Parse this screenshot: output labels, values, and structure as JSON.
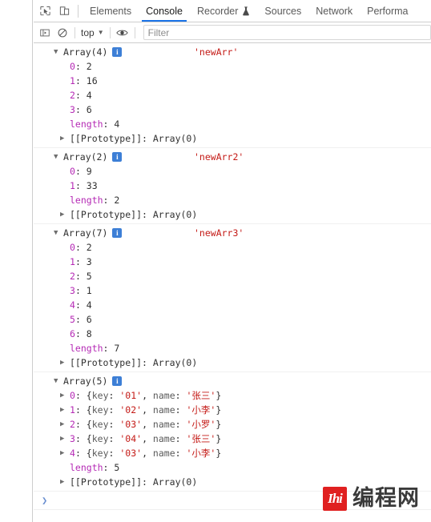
{
  "window": {
    "left_gutter_visible": true
  },
  "tabbar": {
    "inspect_icon": "inspect-element-icon",
    "device_icon": "device-toolbar-icon",
    "tabs": [
      {
        "label": "Elements",
        "active": false,
        "icon": null
      },
      {
        "label": "Console",
        "active": true,
        "icon": null
      },
      {
        "label": "Recorder",
        "active": false,
        "icon": "beaker-icon"
      },
      {
        "label": "Sources",
        "active": false,
        "icon": null
      },
      {
        "label": "Network",
        "active": false,
        "icon": null
      },
      {
        "label": "Performa",
        "active": false,
        "icon": null
      }
    ]
  },
  "consolebar": {
    "sidebar_icon": "console-sidebar-icon",
    "clear_icon": "clear-console-icon",
    "context_label": "top",
    "context_caret": "▼",
    "eye_icon": "live-expression-eye-icon",
    "filter_placeholder": "Filter",
    "filter_value": ""
  },
  "console": {
    "entries": [
      {
        "header": "Array(4)",
        "badge": "i",
        "label": "'newArr'",
        "children": [
          {
            "key": "0",
            "value": "2"
          },
          {
            "key": "1",
            "value": "16"
          },
          {
            "key": "2",
            "value": "4"
          },
          {
            "key": "3",
            "value": "6"
          }
        ],
        "length_key": "length",
        "length_value": "4",
        "proto_key": "[[Prototype]]",
        "proto_value": "Array(0)"
      },
      {
        "header": "Array(2)",
        "badge": "i",
        "label": "'newArr2'",
        "children": [
          {
            "key": "0",
            "value": "9"
          },
          {
            "key": "1",
            "value": "33"
          }
        ],
        "length_key": "length",
        "length_value": "2",
        "proto_key": "[[Prototype]]",
        "proto_value": "Array(0)"
      },
      {
        "header": "Array(7)",
        "badge": "i",
        "label": "'newArr3'",
        "children": [
          {
            "key": "0",
            "value": "2"
          },
          {
            "key": "1",
            "value": "3"
          },
          {
            "key": "2",
            "value": "5"
          },
          {
            "key": "3",
            "value": "1"
          },
          {
            "key": "4",
            "value": "4"
          },
          {
            "key": "5",
            "value": "6"
          },
          {
            "key": "6",
            "value": "8"
          }
        ],
        "length_key": "length",
        "length_value": "7",
        "proto_key": "[[Prototype]]",
        "proto_value": "Array(0)"
      },
      {
        "header": "Array(5)",
        "badge": "i",
        "label": "",
        "object_children": [
          {
            "key": "0",
            "obj_key": "'01'",
            "obj_name": "'张三'"
          },
          {
            "key": "1",
            "obj_key": "'02'",
            "obj_name": "'小李'"
          },
          {
            "key": "2",
            "obj_key": "'03'",
            "obj_name": "'小罗'"
          },
          {
            "key": "3",
            "obj_key": "'04'",
            "obj_name": "'张三'"
          },
          {
            "key": "4",
            "obj_key": "'03'",
            "obj_name": "'小李'"
          }
        ],
        "obj_field1": "key",
        "obj_field2": "name",
        "length_key": "length",
        "length_value": "5",
        "proto_key": "[[Prototype]]",
        "proto_value": "Array(0)"
      }
    ],
    "prompt_caret": "❯"
  },
  "watermark": {
    "logo_text": "Ihi",
    "text": "编程网"
  },
  "colors": {
    "accent": "#1a73e8",
    "string": "#c41a16",
    "key": "#b52ab5",
    "badge": "#3d7fd6",
    "watermark_red": "#e02020"
  }
}
